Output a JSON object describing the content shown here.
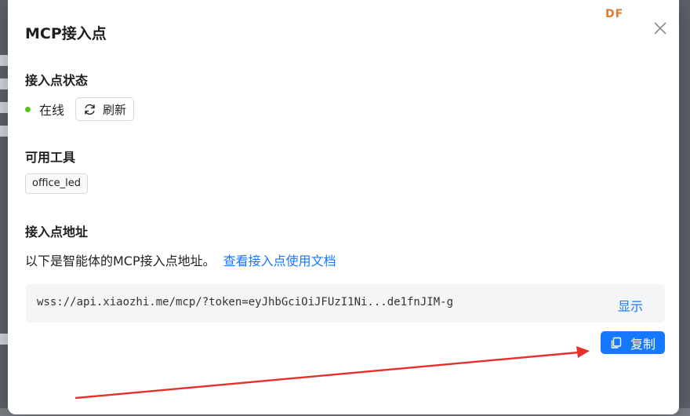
{
  "dialog": {
    "title": "MCP接入点",
    "watermark": "DF"
  },
  "status_section": {
    "title": "接入点状态",
    "status": "在线",
    "status_color": "#52c41a",
    "refresh_label": "刷新"
  },
  "tools_section": {
    "title": "可用工具",
    "tools": [
      "office_led"
    ]
  },
  "endpoint_section": {
    "title": "接入点地址",
    "description": "以下是智能体的MCP接入点地址。",
    "doc_link": "查看接入点使用文档",
    "url": "wss://api.xiaozhi.me/mcp/?token=eyJhbGciOiJFUzI1Ni...de1fnJIM-g",
    "show_label": "显示",
    "copy_label": "复制"
  },
  "colors": {
    "accent": "#1677ff",
    "annotation_arrow": "#e8302a"
  }
}
